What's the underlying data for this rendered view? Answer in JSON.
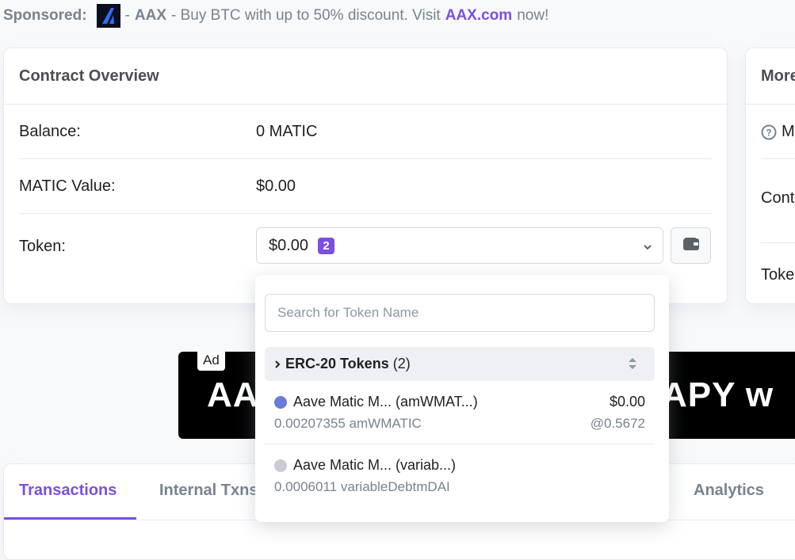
{
  "sponsored": {
    "label": "Sponsored:",
    "dash1": "-",
    "brand": "AAX",
    "message": "- Buy BTC with up to 50% discount. Visit",
    "link": "AAX.com",
    "tail": "now!"
  },
  "overview": {
    "title": "Contract Overview",
    "balance_label": "Balance:",
    "balance_value": "0 MATIC",
    "value_label": "MATIC Value:",
    "value_value": "$0.00",
    "token_label": "Token:",
    "token_select_value": "$0.00",
    "token_count": "2"
  },
  "more_info": {
    "title": "More",
    "row1": "M",
    "row2": "Cont",
    "row3": "Toke"
  },
  "ad": {
    "tag": "Ad",
    "text_left": "AA",
    "text_right": "APY w"
  },
  "tabs": {
    "items": [
      "Transactions",
      "Internal Txns",
      "Analytics"
    ]
  },
  "token_dropdown": {
    "search_placeholder": "Search for Token Name",
    "group_name": "ERC-20 Tokens",
    "group_count": "(2)",
    "items": [
      {
        "name": "Aave Matic M... (amWMAT...)",
        "value": "$0.00",
        "amount": "0.00207355 amWMATIC",
        "rate": "@0.5672",
        "icon_color": "#6b7bd8"
      },
      {
        "name": "Aave Matic M... (variab...)",
        "value": "",
        "amount": "0.0006011 variableDebtmDAI",
        "rate": "",
        "icon_color": "#c9ccd4"
      }
    ]
  },
  "colors": {
    "accent": "#7b4fe0",
    "muted": "#77838f",
    "border": "#e7eaf3"
  }
}
